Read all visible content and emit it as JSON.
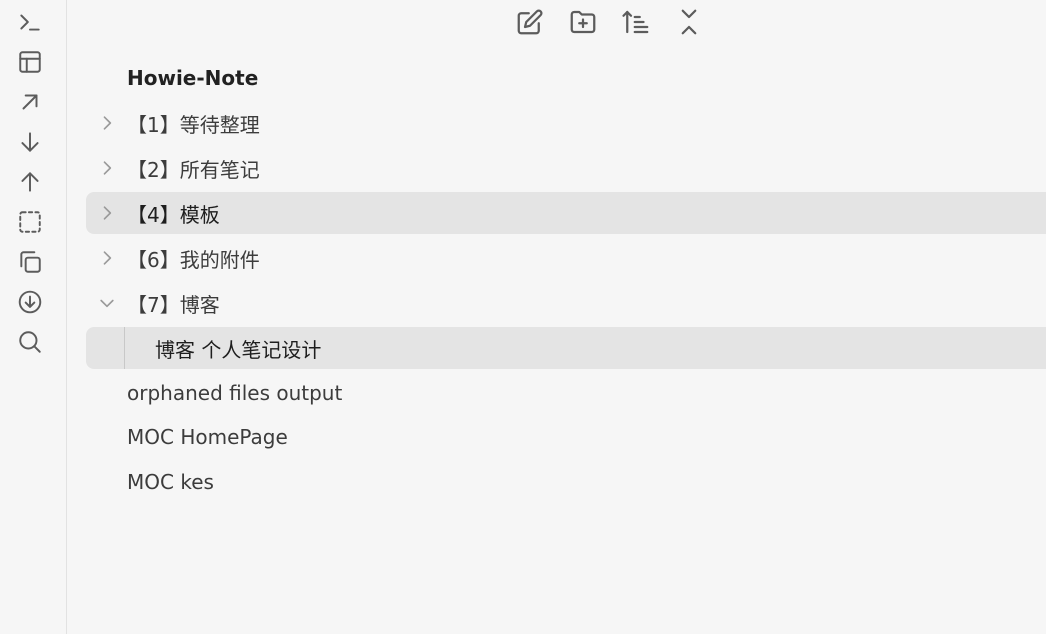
{
  "ribbon": {
    "items": [
      {
        "icon": "terminal-icon"
      },
      {
        "icon": "layout-icon"
      },
      {
        "icon": "arrow-up-right-icon"
      },
      {
        "icon": "arrow-down-icon"
      },
      {
        "icon": "arrow-up-icon"
      },
      {
        "icon": "dashed-square-icon"
      },
      {
        "icon": "copy-icon"
      },
      {
        "icon": "download-circle-icon"
      },
      {
        "icon": "search-icon"
      }
    ]
  },
  "nav_header": {
    "buttons": [
      {
        "icon": "new-note-icon"
      },
      {
        "icon": "new-folder-icon"
      },
      {
        "icon": "sort-icon"
      },
      {
        "icon": "collapse-all-icon"
      }
    ]
  },
  "tree": {
    "root_title": "Howie-Note",
    "items": [
      {
        "label": "【1】等待整理",
        "type": "folder",
        "expanded": false
      },
      {
        "label": "【2】所有笔记",
        "type": "folder",
        "expanded": false
      },
      {
        "label": "【4】模板",
        "type": "folder",
        "expanded": false,
        "selected": true
      },
      {
        "label": "【6】我的附件",
        "type": "folder",
        "expanded": false
      },
      {
        "label": "【7】博客",
        "type": "folder",
        "expanded": true
      },
      {
        "label": "博客 个人笔记设计",
        "type": "file",
        "parent": "【7】博客",
        "selected": true
      },
      {
        "label": "orphaned files output",
        "type": "file"
      },
      {
        "label": "MOC HomePage",
        "type": "file"
      },
      {
        "label": "MOC kes",
        "type": "file"
      }
    ]
  },
  "colors": {
    "background": "#f6f6f6",
    "selected_bg": "#e4e4e4",
    "icon": "#5c5c5c",
    "chevron": "#9a9a9a"
  }
}
